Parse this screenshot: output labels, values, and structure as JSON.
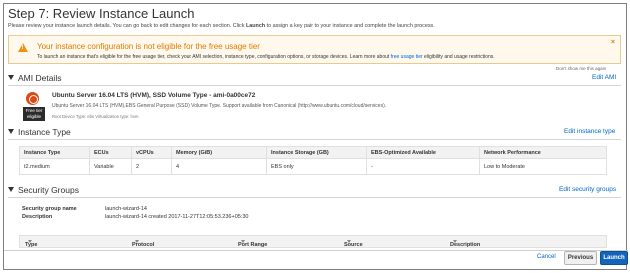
{
  "page": {
    "title": "Step 7: Review Instance Launch",
    "intro_before": "Please review your instance launch details. You can go back to edit changes for each section. Click ",
    "intro_bold": "Launch",
    "intro_after": " to assign a key pair to your instance and complete the launch process."
  },
  "warning": {
    "title": "Your instance configuration is not eligible for the free usage tier",
    "text_before": "To launch an instance that's eligible for the free usage tier, check your AMI selection, instance type, configuration options, or storage devices. Learn more about ",
    "link": "free usage tier",
    "text_after": " eligibility and usage restrictions.",
    "icon_glyph": "!",
    "close_glyph": "×",
    "dont_show": "Don't show me this again",
    "color": "#e07b00"
  },
  "ami": {
    "header": "AMI Details",
    "edit": "Edit AMI",
    "name": "Ubuntu Server 16.04 LTS (HVM), SSD Volume Type - ami-0a00ce72",
    "description": "Ubuntu Server 16.04 LTS (HVM),EBS General Purpose (SSD) Volume Type. Support available from Canonical (http://www.ubuntu.com/cloud/services).",
    "meta": "Root Device Type: ebs    Virtualization type: hvm",
    "badge_line1": "Free tier",
    "badge_line2": "eligible"
  },
  "instance_type": {
    "header": "Instance Type",
    "edit": "Edit instance type",
    "columns": [
      "Instance Type",
      "ECUs",
      "vCPUs",
      "Memory (GiB)",
      "Instance Storage (GB)",
      "EBS-Optimized Available",
      "Network Performance"
    ],
    "row": [
      "t2.medium",
      "Variable",
      "2",
      "4",
      "EBS only",
      "-",
      "Low to Moderate"
    ]
  },
  "security_groups": {
    "header": "Security Groups",
    "edit": "Edit security groups",
    "name_label": "Security group name",
    "name_value": "launch-wizard-14",
    "desc_label": "Description",
    "desc_value": "launch-wizard-14 created 2017-11-27T12:05:53.236+05:30",
    "columns": [
      "Type",
      "Protocol",
      "Port Range",
      "Source",
      "Description"
    ]
  },
  "footer": {
    "cancel": "Cancel",
    "previous": "Previous",
    "launch": "Launch"
  },
  "colors": {
    "link": "#0066cc",
    "launch_button": "#1166bb",
    "warning_bg": "#fff8ed"
  }
}
